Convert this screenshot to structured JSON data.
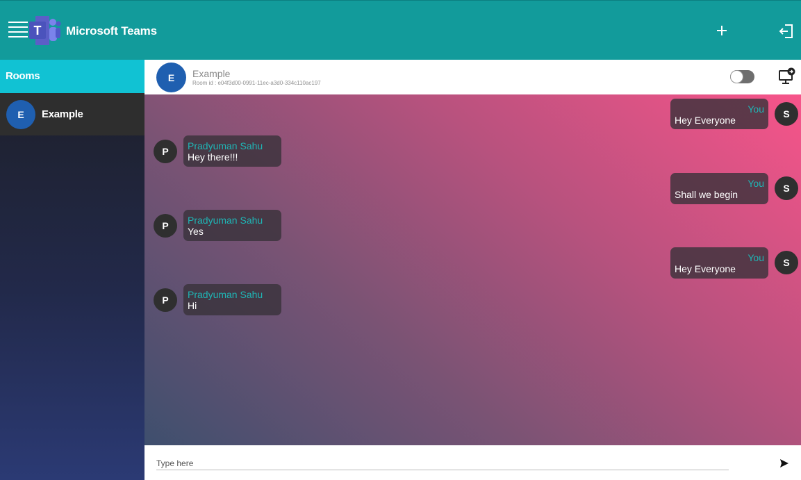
{
  "app": {
    "title": "Microsoft Teams"
  },
  "sidebar": {
    "header": "Rooms",
    "rooms": [
      {
        "initial": "E",
        "name": "Example"
      }
    ]
  },
  "chat": {
    "room_initial": "E",
    "room_name": "Example",
    "room_id": "Room id : e04f3d00-0991-11ec-a3d0-334c110ac197",
    "messages": [
      {
        "sender": "You",
        "initial": "S",
        "text": "Hey Everyone",
        "mine": true
      },
      {
        "sender": "Pradyuman Sahu",
        "initial": "P",
        "text": "Hey there!!!",
        "mine": false
      },
      {
        "sender": "You",
        "initial": "S",
        "text": "Shall we begin",
        "mine": true
      },
      {
        "sender": "Pradyuman Sahu",
        "initial": "P",
        "text": "Yes",
        "mine": false
      },
      {
        "sender": "You",
        "initial": "S",
        "text": "Hey Everyone",
        "mine": true
      },
      {
        "sender": "Pradyuman Sahu",
        "initial": "P",
        "text": "Hi",
        "mine": false
      }
    ]
  },
  "composer": {
    "placeholder": "Type here"
  },
  "icons": {
    "menu": "hamburger-menu-icon",
    "logo": "teams-logo-icon",
    "add": "plus-icon",
    "leave": "exit-icon",
    "toggle": "toggle-switch",
    "screen_share": "screen-share-icon",
    "send": "send-icon"
  },
  "colors": {
    "topbar": "#129b9b",
    "rooms_header": "#11c2d3",
    "accent_name": "#1fb5b5",
    "room_avatar": "#1f5fb0"
  }
}
